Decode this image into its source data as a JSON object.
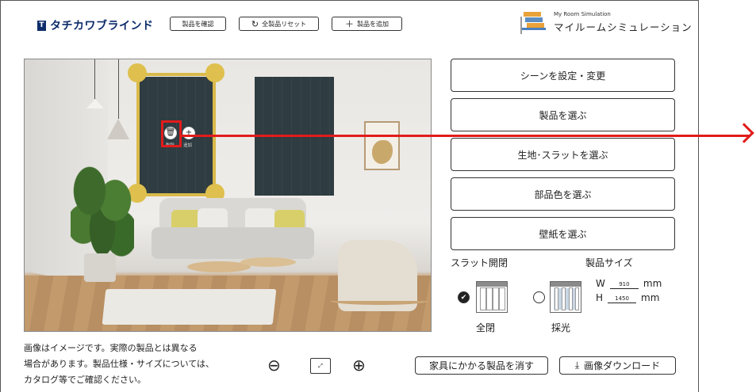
{
  "brand": {
    "logo_text": "タチカワブラインド"
  },
  "toolbar": {
    "confirm_label": "製品を確認",
    "reset_label": "全製品リセット",
    "add_label": "製品を追加"
  },
  "sim": {
    "title_en": "My Room Simulation",
    "title_jp": "マイルームシミュレーション"
  },
  "room": {
    "delete_label": "削除",
    "add_label": "追加"
  },
  "panel": {
    "scene_label": "シーンを設定・変更",
    "product_label": "製品を選ぶ",
    "fabric_label": "生地･スラットを選ぶ",
    "part_color_label": "部品色を選ぶ",
    "wallpaper_label": "壁紙を選ぶ"
  },
  "slat": {
    "title": "スラット開閉",
    "options": [
      {
        "label": "全閉",
        "selected": true
      },
      {
        "label": "採光",
        "selected": false
      }
    ]
  },
  "size": {
    "title": "製品サイズ",
    "w_label": "W",
    "w_value": "910",
    "h_label": "H",
    "h_value": "1450",
    "unit": "mm"
  },
  "footer": {
    "note_line1": "画像はイメージです。実際の製品とは異なる",
    "note_line2": "場合があります。製品仕様・サイズについては、",
    "note_line3": "カタログ等でご確認ください。",
    "hide_label": "家具にかかる製品を消す",
    "download_label": "画像ダウンロード"
  },
  "colors": {
    "selection": "#d8b94a",
    "highlight": "#e21b1b",
    "blind": "#2f3c41",
    "brand": "#0d2d6b"
  }
}
